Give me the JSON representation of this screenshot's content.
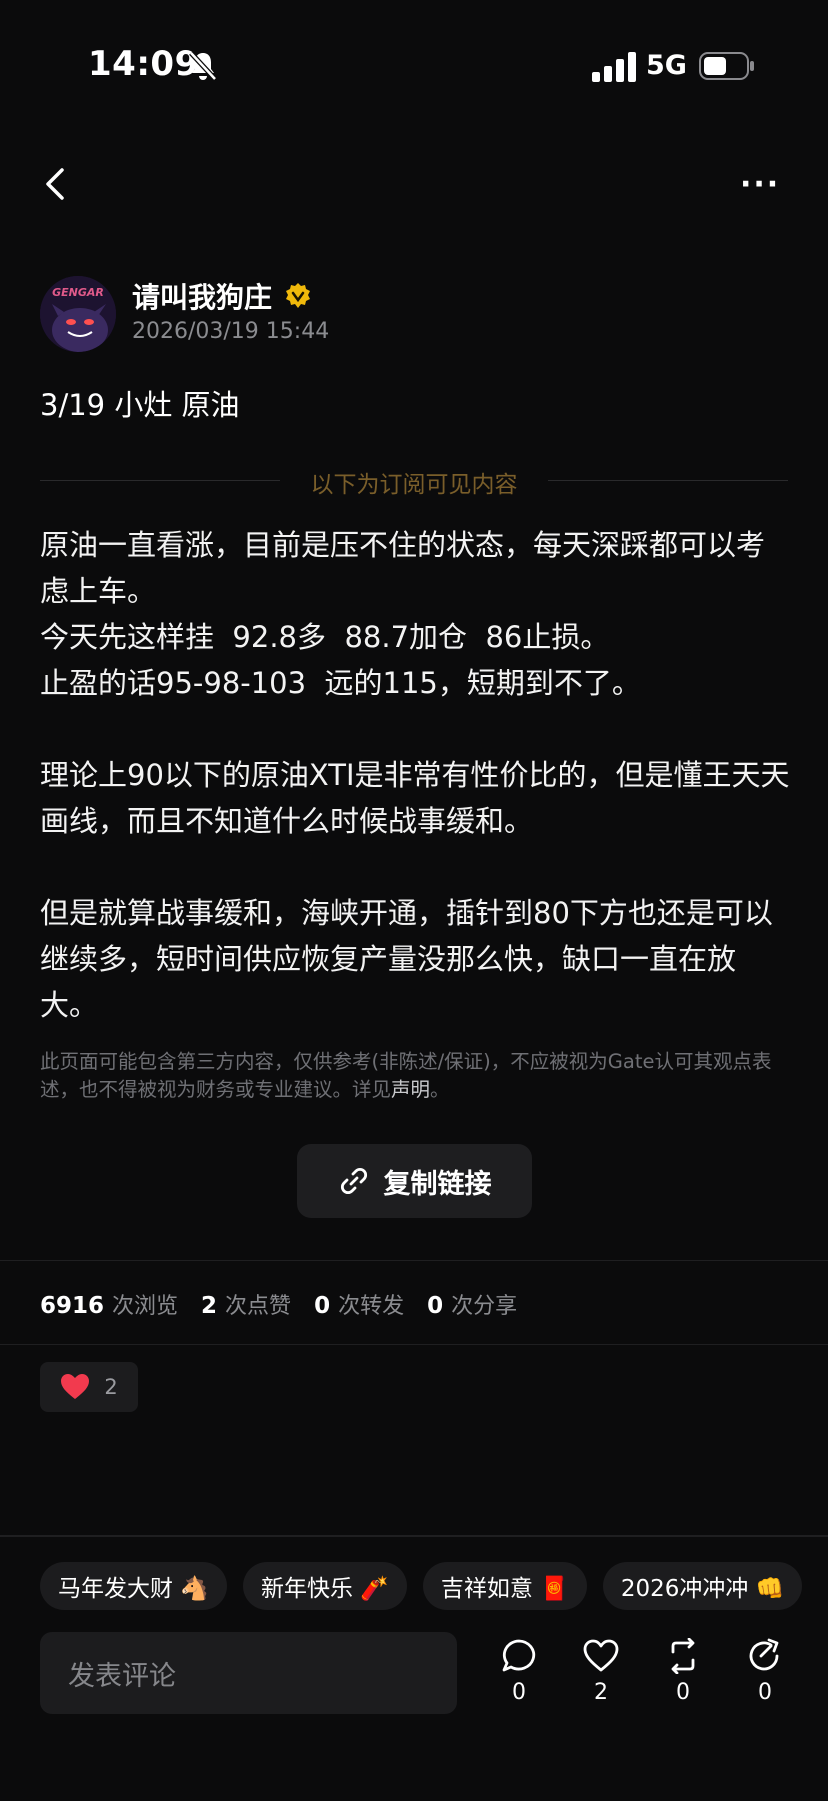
{
  "status_bar": {
    "time": "14:09",
    "network": "5G",
    "icons": [
      "bell-off-icon",
      "signal-icon",
      "battery-icon"
    ]
  },
  "nav": {
    "back_icon": "chevron-left-icon",
    "more_label": "···"
  },
  "author": {
    "name": "请叫我狗庄",
    "avatar_text": "GENGAR",
    "verified_icon": "verified-badge-icon",
    "post_time": "2026/03/19 15:44"
  },
  "post": {
    "title": "3/19 小灶 原油",
    "subscriber_divider": "以下为订阅可见内容",
    "paragraphs": [
      "原油一直看涨，目前是压不住的状态，每天深踩都可以考虑上车。\n今天先这样挂  92.8多  88.7加仓  86止损。\n止盈的话95-98-103  远的115，短期到不了。",
      "理论上90以下的原油XTI是非常有性价比的，但是懂王天天画线，而且不知道什么时候战事缓和。",
      "但是就算战事缓和，海峡开通，插针到80下方也还是可以继续多，短时间供应恢复产量没那么快，缺口一直在放大。"
    ],
    "disclaimer": "此页面可能包含第三方内容，仅供参考(非陈述/保证)，不应被视为Gate认可其观点表述，也不得被视为财务或专业建议。详见",
    "disclaimer_link": "声明",
    "disclaimer_end": "。"
  },
  "copy_link": {
    "label": "复制链接",
    "icon": "link-icon"
  },
  "stats": {
    "views": "6916",
    "views_label": "次浏览",
    "likes": "2",
    "likes_label": "次点赞",
    "reposts": "0",
    "reposts_label": "次转发",
    "shares": "0",
    "shares_label": "次分享"
  },
  "reaction": {
    "icon": "heart-icon",
    "count": "2"
  },
  "quick_comments": [
    {
      "label": "马年发大财 🐴"
    },
    {
      "label": "新年快乐 🧨"
    },
    {
      "label": "吉祥如意 🧧"
    },
    {
      "label": "2026冲冲冲 👊"
    }
  ],
  "comment_bar": {
    "placeholder": "发表评论",
    "comments": "0",
    "likes": "2",
    "reposts": "0",
    "shares": "0"
  },
  "colors": {
    "background": "#0b0b0c",
    "heart": "#f23a4e",
    "verified": "#f0b90b",
    "divider_text": "#7a5e2a"
  }
}
